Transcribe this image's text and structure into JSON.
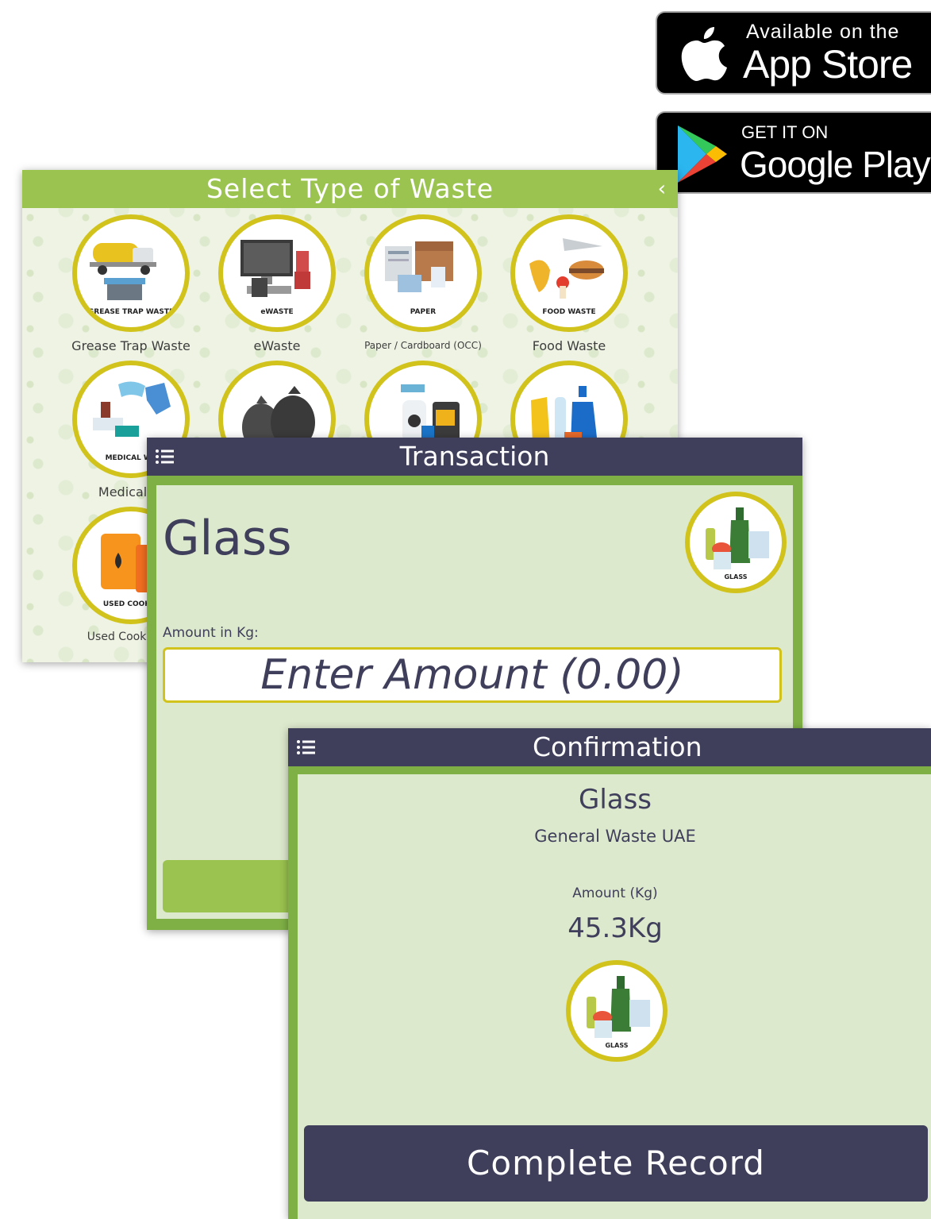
{
  "badges": {
    "apple": {
      "small": "Available on the",
      "big": "App Store"
    },
    "google": {
      "small": "GET IT ON",
      "big": "Google Play"
    }
  },
  "select_screen": {
    "title": "Select Type of Waste",
    "back_icon": "chevron-left-icon",
    "tiles": [
      {
        "label": "Grease Trap Waste",
        "badge": "GREASE TRAP WASTE",
        "icon": "grease-trap-truck-icon"
      },
      {
        "label": "eWaste",
        "badge": "eWASTE",
        "icon": "computer-ewaste-icon"
      },
      {
        "label": "Paper / Cardboard (OCC)",
        "badge": "PAPER",
        "icon": "paper-cardboard-icon"
      },
      {
        "label": "Food Waste",
        "badge": "FOOD WASTE",
        "icon": "food-waste-icon"
      },
      {
        "label": "Medical W",
        "badge": "MEDICAL WA",
        "icon": "medical-waste-icon"
      },
      {
        "label": "",
        "badge": "",
        "icon": "garbage-bags-icon"
      },
      {
        "label": "",
        "badge": "",
        "icon": "hazardous-chemicals-icon"
      },
      {
        "label": "",
        "badge": "",
        "icon": "plastic-bottles-icon"
      },
      {
        "label": "Used Cooking C",
        "badge": "USED COOKIN",
        "icon": "used-cooking-oil-icon"
      }
    ]
  },
  "transaction_screen": {
    "title": "Transaction",
    "material": "Glass",
    "material_badge": "GLASS",
    "amount_label": "Amount in Kg:",
    "amount_placeholder": "Enter Amount (0.00)"
  },
  "confirmation_screen": {
    "title": "Confirmation",
    "material": "Glass",
    "category": "General Waste UAE",
    "amount_label": "Amount (Kg)",
    "amount_value": "45.3Kg",
    "material_badge": "GLASS",
    "complete_button": "Complete Record"
  },
  "colors": {
    "green_header": "#9bc350",
    "dark_header": "#3f3e5b",
    "ring_yellow": "#d1c31c",
    "panel_bg": "#dde9cd"
  }
}
